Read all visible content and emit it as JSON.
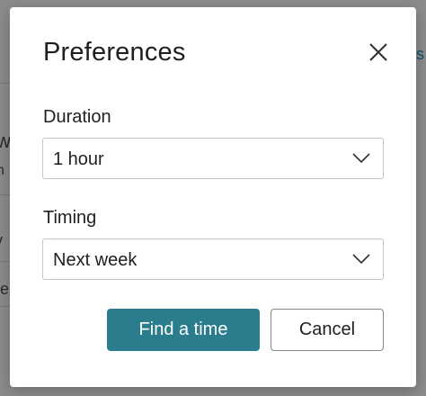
{
  "background": {
    "fragments": [
      "w",
      "n",
      "y",
      "re"
    ],
    "right_fragment": "s"
  },
  "dialog": {
    "title": "Preferences",
    "close_icon": "close-icon",
    "duration": {
      "label": "Duration",
      "selected": "1 hour",
      "icon": "chevron-down-icon"
    },
    "timing": {
      "label": "Timing",
      "selected": "Next week",
      "icon": "chevron-down-icon"
    },
    "actions": {
      "primary_label": "Find a time",
      "secondary_label": "Cancel"
    }
  },
  "colors": {
    "primary": "#2a7d8c",
    "text": "#201f1e",
    "border": "#c8c6c4",
    "overlay": "#8c8c8c"
  }
}
